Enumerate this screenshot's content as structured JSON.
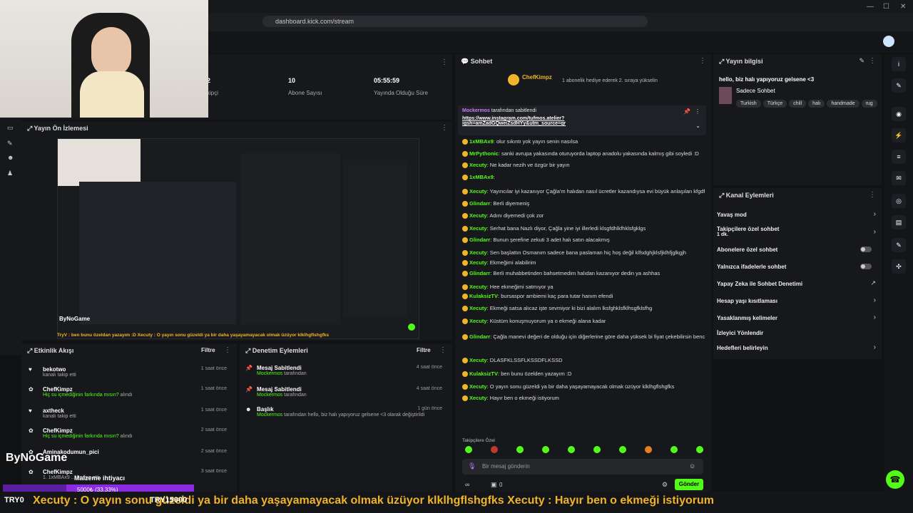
{
  "browser": {
    "url": "dashboard.kick.com/stream"
  },
  "stats": [
    {
      "value": "2",
      "label": "kipçi"
    },
    {
      "value": "10",
      "label": "Abone Sayısı"
    },
    {
      "value": "05:55:59",
      "label": "Yayında Olduğu Süre"
    }
  ],
  "preview": {
    "title": "Yayın Ön İzlemesi",
    "overlay_brand": "ByNoGame",
    "overlay_text": "TryV : ben bunu özeldan yazayım :D   Xecuty : O yayın sonu güzeldi ya bir daha yaşayamayacak olmak üzüyor klklhgflshgfks"
  },
  "activity": {
    "title": "Etkinlik Akışı",
    "filter": "Filtre",
    "items": [
      {
        "name": "bekotwo",
        "sub": "kanalı takip etti",
        "time": "1 saat önce"
      },
      {
        "name": "ChefKimpz",
        "sub_green": "Hiç su içmediğinin farkında mısın?",
        "sub": "alındı",
        "time": "1 saat önce"
      },
      {
        "name": "axtheck",
        "sub": "kanalı takip etti",
        "time": "1 saat önce"
      },
      {
        "name": "ChefKimpz",
        "sub_green": "Hiç su içmediğinin farkında mısın?",
        "sub": "alındı",
        "time": "2 saat önce"
      },
      {
        "name": "Aminakodumun_pici",
        "sub": "",
        "time": "2 saat önce"
      },
      {
        "name": "ChefKimpz",
        "sub": "1. 1xMBAx9 ... hediye etti.",
        "time": "3 saat önce"
      }
    ]
  },
  "moderation": {
    "title": "Denetim Eylemleri",
    "filter": "Filtre",
    "items": [
      {
        "name": "Mesaj Sabitlendi",
        "by": "Mockermos",
        "sub": "tarafından",
        "time": "4 saat önce"
      },
      {
        "name": "Mesaj Sabitlendi",
        "by": "Mockermos",
        "sub": "tarafından",
        "time": "4 saat önce"
      },
      {
        "name": "Başlık",
        "by": "Mockermos",
        "sub": "tarafından hello, biz halı yapıyoruz gelsene <3 olarak değiştirildi",
        "time": "1 gün önce"
      }
    ]
  },
  "chat": {
    "title": "Sohbet",
    "top_user": "ChefKimpz",
    "top_note": "1 abonelik hediye ederek 2. sıraya yükselin",
    "pinned_by": "Mockermos",
    "pinned_suffix": "tarafından sabitlendi",
    "pinned_link": "https://www.instagram.com/tufmos.atelier?igsh=amZadGQweiZsdHYy&utm_source=qr",
    "messages": [
      {
        "u": "1xMBAx9",
        "t": "olur sıkıntı yok yayın senin nasılsa"
      },
      {
        "u": "MrPythonic",
        "t": "sanki avrupa yakasında oturuyorda laptop anadolu yakasında kalmış gibi soyledi :D"
      },
      {
        "u": "Xecuty",
        "t": "Ne kadar nezih ve özgür bir yayın"
      },
      {
        "u": "1xMBAx9",
        "t": ""
      },
      {
        "u": "Xecuty",
        "t": "Yayıncılar iyi kazanıyor Çağla'm halıdan nasıl ücretler kazandıysa evi büyük anlaşılan kfgdfgkldfkgld"
      },
      {
        "u": "Glindarr",
        "t": "Berli diyemeniş"
      },
      {
        "u": "Xecuty",
        "t": "Adını diyemedi çok zor"
      },
      {
        "u": "Xecuty",
        "t": "Serhat bana Nazlı diyor, Çağla yine iyi illerledi klsgfdhlkfhklsfgklgs"
      },
      {
        "u": "Glindarr",
        "t": "Bunun şerefine zekuti 3 adet halı satın alacakmış"
      },
      {
        "u": "Xecuty",
        "t": "Sen başlattın Osmanım sadece bana paslaman hiç hoş değil klfsdghjklsfjklhfjglkgjh"
      },
      {
        "u": "Xecuty",
        "t": "Ekmeğimi alabilirim"
      },
      {
        "u": "Glindarr",
        "t": "Berli muhabbetinden bahsetmedim halıdan kazanıyor dedin ya ashhas"
      },
      {
        "u": "Xecuty",
        "t": "Hee ekmeğimi satmıyor ya"
      },
      {
        "u": "KulaksizTV",
        "t": "bursaspor ambiemi kaç para tutar hanım efendi"
      },
      {
        "u": "Xecuty",
        "t": "Ekmeği satsa alıcaz işte sevmiyor ki bizi alalım lksfghklsfklhsgfklsfhg"
      },
      {
        "u": "Xecuty",
        "t": "Küstüm konuşmuyorum ya o ekmeği alana kadar"
      },
      {
        "u": "Glindarr",
        "t": "Çağla manevi değeri de olduğu için diğerlerine göre daha yüksek bi fiyat çekebilirsin bence ekmeğe zekuti için hashashas"
      },
      {
        "u": "Xecuty",
        "t": "DLASFKLSSFLKSSDFLKSSD"
      },
      {
        "u": "KulaksizTV",
        "t": "ben bunu özelden yazayım :D"
      },
      {
        "u": "Xecuty",
        "t": "O yayın sonu güzeldi ya bir daha yaşayamayacak olmak üzüyor klklhgflshgfks"
      },
      {
        "u": "Xecuty",
        "t": "Hayır ben o ekmeği istiyorum"
      }
    ],
    "followers_only": "Takipçilere Özel",
    "input_placeholder": "Bir mesaj gönderin",
    "send_label": "Gönder",
    "viewer_count": "0"
  },
  "stream_info": {
    "title": "Yayın bilgisi",
    "stream_title": "hello, biz halı yapıyoruz gelsene <3",
    "category": "Sadece Sohbet",
    "tags": [
      "Turkish",
      "Türkçe",
      "chill",
      "halı",
      "handmade",
      "rug"
    ]
  },
  "channel_actions": {
    "title": "Kanal Eylemleri",
    "items": [
      {
        "label": "Yavaş mod",
        "control": "chevron"
      },
      {
        "label": "Takipçilere özel sohbet",
        "sub": "1 dk.",
        "control": "chevron"
      },
      {
        "label": "Abonelere özel sohbet",
        "control": "toggle"
      },
      {
        "label": "Yalnızca ifadelerle sohbet",
        "control": "toggle"
      },
      {
        "label": "Yapay Zeka ile Sohbet Denetimi",
        "control": "external"
      },
      {
        "label": "Hesap yaşı kısıtlaması",
        "control": "chevron"
      },
      {
        "label": "Yasaklanmış kelimeler",
        "control": "chevron"
      },
      {
        "label": "İzleyici Yönlendir",
        "control": "none"
      },
      {
        "label": "Hedefleri belirleyin",
        "control": "chevron"
      }
    ]
  },
  "overlay": {
    "brand": "ByNoGame",
    "goal_title": "Malzeme ihtiyacı",
    "goal_progress": "5000₺ (33.33%)",
    "goal_fraction": 0.3333,
    "goal_min": "TRY0",
    "goal_max": "TRY15000",
    "ticker": "Xecuty : O yayın sonu güzeldi ya bir daha yaşayamayacak olmak üzüyor klklhgflshgfks   Xecuty : Hayır ben o ekmeği istiyorum"
  }
}
